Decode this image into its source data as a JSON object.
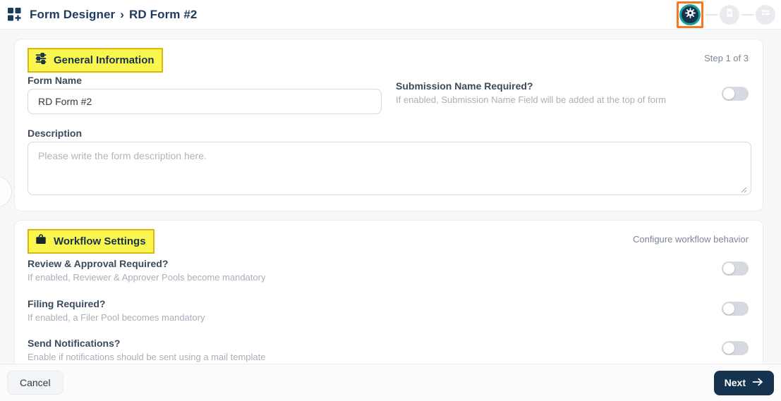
{
  "header": {
    "breadcrumb": {
      "root": "Form Designer",
      "separator": "›",
      "current": "RD Form #2"
    },
    "stepper": {
      "steps": [
        {
          "name": "general-settings",
          "icon": "gear-icon",
          "active": true,
          "annotated": true
        },
        {
          "name": "form-content",
          "icon": "document-icon",
          "active": false
        },
        {
          "name": "form-layout",
          "icon": "layout-grid-icon",
          "active": false
        }
      ]
    }
  },
  "general_section": {
    "title": "General Information",
    "icon": "sliders-icon",
    "step_indicator": "Step 1 of 3",
    "form_name": {
      "label": "Form Name",
      "value": "RD Form #2"
    },
    "submission_name": {
      "label": "Submission Name Required?",
      "description": "If enabled, Submission Name Field will be added at the top of form",
      "enabled": false
    },
    "description": {
      "label": "Description",
      "placeholder": "Please write the form description here.",
      "value": ""
    }
  },
  "workflow_section": {
    "title": "Workflow Settings",
    "icon": "briefcase-icon",
    "subtitle": "Configure workflow behavior",
    "toggles": [
      {
        "label": "Review & Approval Required?",
        "description": "If enabled, Reviewer & Approver Pools become mandatory",
        "enabled": false
      },
      {
        "label": "Filing Required?",
        "description": "If enabled, a Filer Pool becomes mandatory",
        "enabled": false
      },
      {
        "label": "Send Notifications?",
        "description": "Enable if notifications should be sent using a mail template",
        "enabled": false
      }
    ]
  },
  "footer": {
    "cancel_label": "Cancel",
    "next_label": "Next"
  },
  "colors": {
    "accent_navy": "#1e3a5f",
    "step_active_bg": "#15334f",
    "teal_ring": "#12a39e",
    "annotation_orange": "#f4781f",
    "annotation_yellow_bg": "#fbf64d",
    "annotation_yellow_border": "#ddb60f",
    "toggle_off": "#d6dae0",
    "muted_text": "#7d8694"
  }
}
